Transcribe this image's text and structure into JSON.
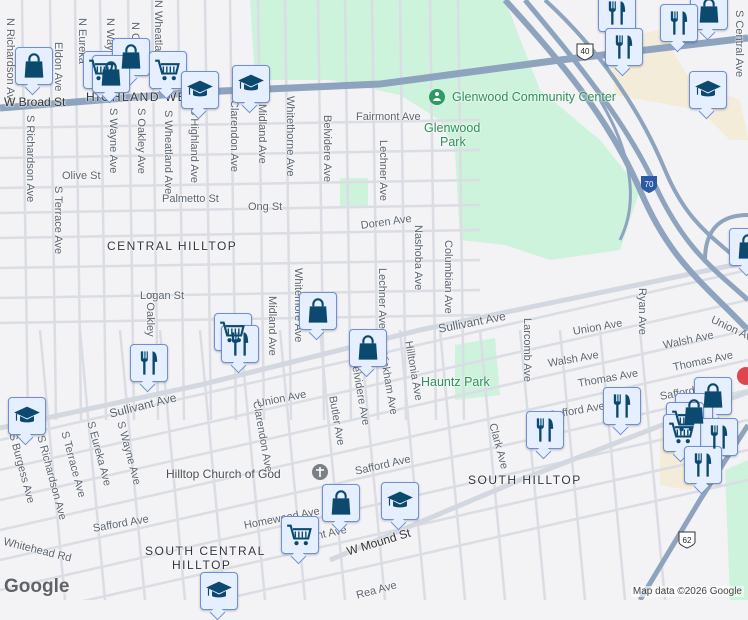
{
  "labels": [
    "N Richardson Ave",
    "Eldon Ave",
    "N Eureka",
    "N Wayne",
    "N Oakley",
    "N Wheatland",
    "S Richardson Ave",
    "S Terrace Ave",
    "S Wayne Ave",
    "S Oakley Ave",
    "S Wheatland Ave",
    "S Highland Ave",
    "Clarendon Ave",
    "Midland Ave",
    "Whitethorne Ave",
    "Belvidere Ave",
    "Lechner Ave",
    "Nashoba Ave",
    "Columbian Ave",
    "Lechner Ave",
    "Whitemore Ave",
    "Midland Ave",
    "S Oakley",
    "Clarendon Ave",
    "Butler Ave",
    "Belvidere Ave",
    "Wickham Ave",
    "Hilltonia Ave",
    "Clark Ave",
    "Larcomb Ave",
    "Ryan Ave",
    "S Central Ave",
    "S Wayne Ave",
    "S Eureka Ave",
    "S Terrace Ave",
    "S Richardson Ave",
    "S Burgess Ave",
    "W Broad St",
    "Fairmont Ave",
    "Olive St",
    "Palmetto St",
    "Ong St",
    "Doren Ave",
    "Logan St",
    "Sullivant Ave",
    "Sullivant Ave",
    "Union Ave",
    "Union Ave",
    "Walsh Ave",
    "Thomas Ave",
    "Walsh Ave",
    "Thomas Ave",
    "Union Ave",
    "Safford Ave",
    "Safford Ave",
    "Safford Ave",
    "Homewood Ave",
    "Safford Ave",
    "Whitehead Rd",
    "Sullivant Ave",
    "W Mound St",
    "Rea Ave"
  ],
  "districts": [
    "HIGHLAND WEST",
    "CENTRAL HILLTOP",
    "SOUTH HILLTOP",
    "SOUTH CENTRAL",
    "HILLTOP"
  ],
  "places": {
    "glenwood_center": "Glenwood Community Center",
    "glenwood_park_1": "Glenwood",
    "glenwood_park_2": "Park",
    "hauntz_park": "Hauntz Park",
    "church": "Hilltop Church of God"
  },
  "shields": {
    "i70": "70",
    "us40": "40",
    "us62": "62"
  },
  "attribution": "Map data ©2026 Google",
  "logo": "Google",
  "colors": {
    "background": "#f3f2f4",
    "park": "#cdf3dc",
    "highway": "#8ea3bd",
    "road": "#dadde4",
    "marker_fill": "#e6efff",
    "marker_border": "#6d8fd6",
    "marker_icon": "#0b4a6e"
  }
}
